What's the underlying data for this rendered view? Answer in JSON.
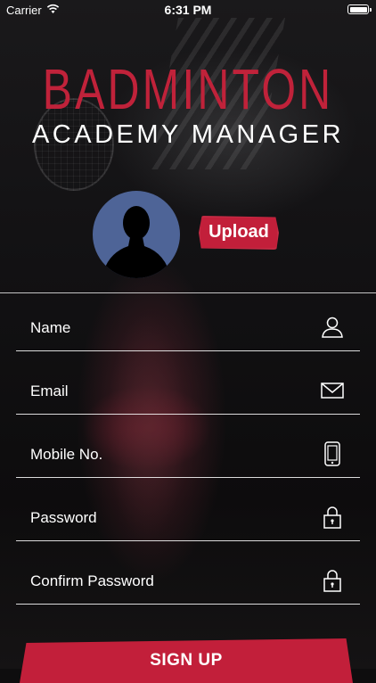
{
  "status_bar": {
    "carrier": "Carrier",
    "time": "6:31 PM"
  },
  "logo": {
    "title": "BADMINTON",
    "subtitle": "ACADEMY MANAGER",
    "title_color": "#c0223a"
  },
  "profile": {
    "upload_label": "Upload",
    "avatar_color": "#4e6497"
  },
  "form": {
    "name_label": "Name",
    "email_label": "Email",
    "mobile_label": "Mobile No.",
    "password_label": "Password",
    "confirm_password_label": "Confirm Password"
  },
  "actions": {
    "signup_label": "SIGN UP",
    "accent_color": "#c21f3a"
  },
  "icons": {
    "name": "user-icon",
    "email": "mail-icon",
    "mobile": "mobile-phone-icon",
    "password": "lock-icon",
    "confirm_password": "lock-icon"
  }
}
